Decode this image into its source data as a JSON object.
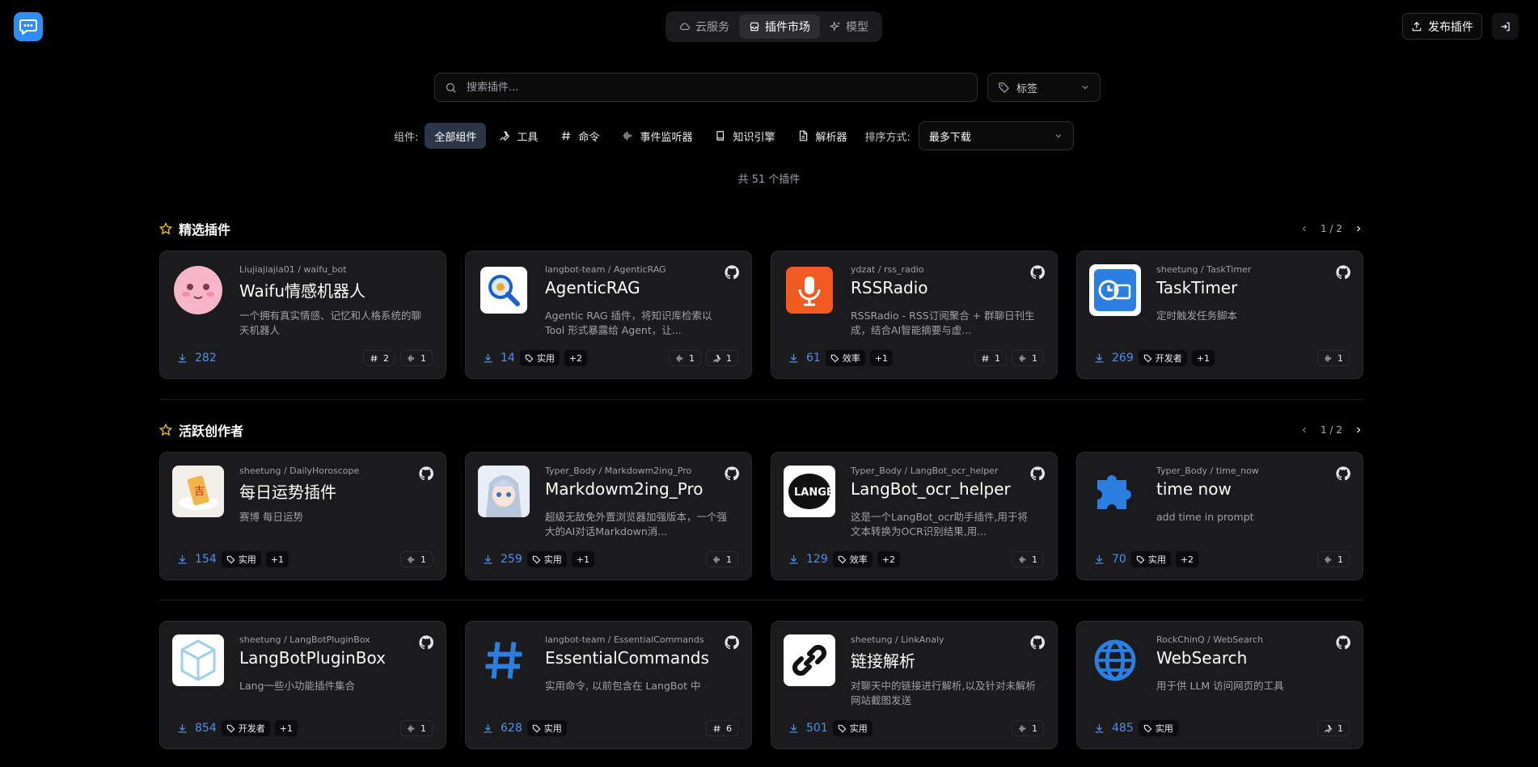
{
  "header": {
    "tabs": [
      {
        "label": "云服务",
        "icon": "cloud-icon"
      },
      {
        "label": "插件市场",
        "icon": "store-icon"
      },
      {
        "label": "模型",
        "icon": "sparkles-icon"
      }
    ],
    "active_tab": 1,
    "publish_label": "发布插件"
  },
  "search": {
    "placeholder": "搜索插件...",
    "value": ""
  },
  "tag_filter": {
    "label": "标签"
  },
  "filters": {
    "label": "组件:",
    "items": [
      {
        "label": "全部组件",
        "icon": ""
      },
      {
        "label": "工具",
        "icon": "wrench-icon"
      },
      {
        "label": "命令",
        "icon": "hash-icon"
      },
      {
        "label": "事件监听器",
        "icon": "audio-wave-icon"
      },
      {
        "label": "知识引擎",
        "icon": "book-icon"
      },
      {
        "label": "解析器",
        "icon": "file-text-icon"
      }
    ],
    "active": 0,
    "sort_label": "排序方式:",
    "sort_value": "最多下载"
  },
  "count_text": "共 51 个插件",
  "sections": [
    {
      "title": "精选插件",
      "page": "1 / 2"
    },
    {
      "title": "活跃创作者",
      "page": "1 / 2"
    }
  ],
  "cards": [
    {
      "path": "Liujiajiajia01 / waifu_bot",
      "name": "Waifu情感机器人",
      "desc": "一个拥有真实情感、记忆和人格系统的聊天机器人",
      "downloads": "282",
      "tags": [],
      "more": "",
      "stats": [
        {
          "icon": "hash-icon",
          "value": "2"
        },
        {
          "icon": "audio-wave-icon",
          "value": "1"
        }
      ],
      "github": false,
      "icon": "waifu"
    },
    {
      "path": "langbot-team / AgenticRAG",
      "name": "AgenticRAG",
      "desc": "Agentic RAG 插件，将知识库检索以 Tool 形式暴露给 Agent，让...",
      "downloads": "14",
      "tags": [
        "实用"
      ],
      "more": "+2",
      "stats": [
        {
          "icon": "audio-wave-icon",
          "value": "1"
        },
        {
          "icon": "wrench-icon",
          "value": "1"
        }
      ],
      "github": true,
      "icon": "rag"
    },
    {
      "path": "ydzat / rss_radio",
      "name": "RSSRadio",
      "desc": "RSSRadio - RSS订阅聚合 + 群聊日刊生成，结合AI智能摘要与虚...",
      "downloads": "61",
      "tags": [
        "效率"
      ],
      "more": "+1",
      "stats": [
        {
          "icon": "hash-icon",
          "value": "1"
        },
        {
          "icon": "audio-wave-icon",
          "value": "1"
        }
      ],
      "github": true,
      "icon": "rss"
    },
    {
      "path": "sheetung / TaskTimer",
      "name": "TaskTimer",
      "desc": "定时触发任务脚本",
      "downloads": "269",
      "tags": [
        "开发者"
      ],
      "more": "+1",
      "stats": [
        {
          "icon": "audio-wave-icon",
          "value": "1"
        }
      ],
      "github": true,
      "icon": "timer"
    },
    {
      "path": "sheetung / DailyHoroscope",
      "name": "每日运势插件",
      "desc": "赛博 每日运势",
      "downloads": "154",
      "tags": [
        "实用"
      ],
      "more": "+1",
      "stats": [
        {
          "icon": "audio-wave-icon",
          "value": "1"
        }
      ],
      "github": true,
      "icon": "horoscope"
    },
    {
      "path": "Typer_Body / Markdowm2ing_Pro",
      "name": "Markdowm2ing_Pro",
      "desc": "超级无敌免外置浏览器加强版本，一个强大的AI对话Markdown消...",
      "downloads": "259",
      "tags": [
        "实用"
      ],
      "more": "+1",
      "stats": [
        {
          "icon": "audio-wave-icon",
          "value": "1"
        }
      ],
      "github": true,
      "icon": "anime"
    },
    {
      "path": "Typer_Body / LangBot_ocr_helper",
      "name": "LangBot_ocr_helper",
      "desc": "这是一个LangBot_ocr助手插件,用于将文本转换为OCR识别结果,用...",
      "downloads": "129",
      "tags": [
        "效率"
      ],
      "more": "+2",
      "stats": [
        {
          "icon": "audio-wave-icon",
          "value": "1"
        }
      ],
      "github": true,
      "icon": "ocr"
    },
    {
      "path": "Typer_Body / time_now",
      "name": "time now",
      "desc": "add time in prompt",
      "downloads": "70",
      "tags": [
        "实用"
      ],
      "more": "+2",
      "stats": [
        {
          "icon": "audio-wave-icon",
          "value": "1"
        }
      ],
      "github": true,
      "icon": "puzzle"
    },
    {
      "path": "sheetung / LangBotPluginBox",
      "name": "LangBotPluginBox",
      "desc": "Lang一些小功能插件集合",
      "downloads": "854",
      "tags": [
        "开发者"
      ],
      "more": "+1",
      "stats": [
        {
          "icon": "audio-wave-icon",
          "value": "1"
        }
      ],
      "github": true,
      "icon": "box"
    },
    {
      "path": "langbot-team / EssentialCommands",
      "name": "EssentialCommands",
      "desc": "实用命令, 以前包含在 LangBot 中",
      "downloads": "628",
      "tags": [
        "实用"
      ],
      "more": "",
      "stats": [
        {
          "icon": "hash-icon",
          "value": "6"
        }
      ],
      "github": true,
      "icon": "hash"
    },
    {
      "path": "sheetung / LinkAnaly",
      "name": "链接解析",
      "desc": "对聊天中的链接进行解析,以及针对未解析网站截图发送",
      "downloads": "501",
      "tags": [
        "实用"
      ],
      "more": "",
      "stats": [
        {
          "icon": "audio-wave-icon",
          "value": "1"
        }
      ],
      "github": true,
      "icon": "link"
    },
    {
      "path": "RockChinQ / WebSearch",
      "name": "WebSearch",
      "desc": "用于供 LLM 访问网页的工具",
      "downloads": "485",
      "tags": [
        "实用"
      ],
      "more": "",
      "stats": [
        {
          "icon": "wrench-icon",
          "value": "1"
        }
      ],
      "github": true,
      "icon": "globe"
    }
  ],
  "colors": {
    "accent": "#4f8fef",
    "star": "#f5c518",
    "background": "#000000",
    "card": "#1b1b1e"
  }
}
